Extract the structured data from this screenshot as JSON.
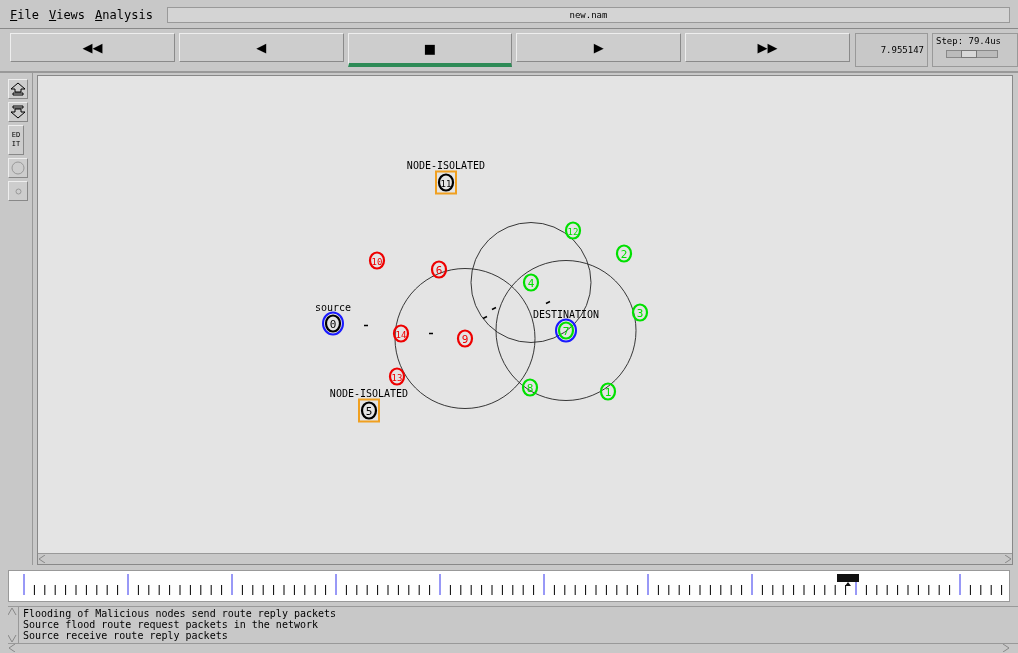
{
  "menu": [
    {
      "label": "File"
    },
    {
      "label": "Views"
    },
    {
      "label": "Analysis"
    }
  ],
  "window": {
    "title": "new.nam"
  },
  "controls": [
    {
      "glyph": "◀◀",
      "selected": false
    },
    {
      "glyph": "◀",
      "selected": false
    },
    {
      "glyph": "■",
      "selected": true
    },
    {
      "glyph": "▶",
      "selected": false
    },
    {
      "glyph": "▶▶",
      "selected": false
    }
  ],
  "time": "7.955147",
  "step": {
    "label": "Step: 79.4us",
    "level": 0.45
  },
  "tools": [
    {
      "kind": "zoom-in"
    },
    {
      "kind": "zoom-out"
    },
    {
      "kind": "edit",
      "label": "ED IT"
    },
    {
      "kind": "circle"
    },
    {
      "kind": "dot"
    }
  ],
  "nodes": [
    {
      "label": "11",
      "color": "#000000",
      "kind": "boxed",
      "tag": "NODE-ISOLATED",
      "range": false
    },
    {
      "label": "12",
      "color": "#00e000",
      "kind": "plain",
      "range": false
    },
    {
      "label": "2",
      "color": "#00e000",
      "kind": "plain",
      "range": false
    },
    {
      "label": "10",
      "color": "#ee0000",
      "kind": "plain",
      "range": false
    },
    {
      "label": "6",
      "color": "#ee0000",
      "kind": "plain",
      "range": false
    },
    {
      "label": "4",
      "color": "#00e000",
      "kind": "plain",
      "range": true
    },
    {
      "label": "0",
      "color": "#000000",
      "kind": "ringed",
      "tag": "source",
      "range": false
    },
    {
      "label": "14",
      "color": "#ee0000",
      "kind": "plain",
      "range": false
    },
    {
      "label": "9",
      "color": "#ee0000",
      "kind": "plain",
      "range": true
    },
    {
      "label": "7",
      "color": "#00e000",
      "kind": "ringed",
      "tag": "DESTINATION",
      "range": true
    },
    {
      "label": "3",
      "color": "#00e000",
      "kind": "plain",
      "range": false
    },
    {
      "label": "13",
      "color": "#ee0000",
      "kind": "plain",
      "range": false
    },
    {
      "label": "5",
      "color": "#000000",
      "kind": "boxed",
      "tag": "NODE-ISOLATED",
      "range": false
    },
    {
      "label": "8",
      "color": "#00e000",
      "kind": "plain",
      "range": false
    },
    {
      "label": "1",
      "color": "#00e000",
      "kind": "plain",
      "range": false
    }
  ],
  "annotations": [
    "Flooding of Malicious nodes send route reply packets",
    "Source flood route request packets in the network",
    "Source receive route reply packets"
  ]
}
